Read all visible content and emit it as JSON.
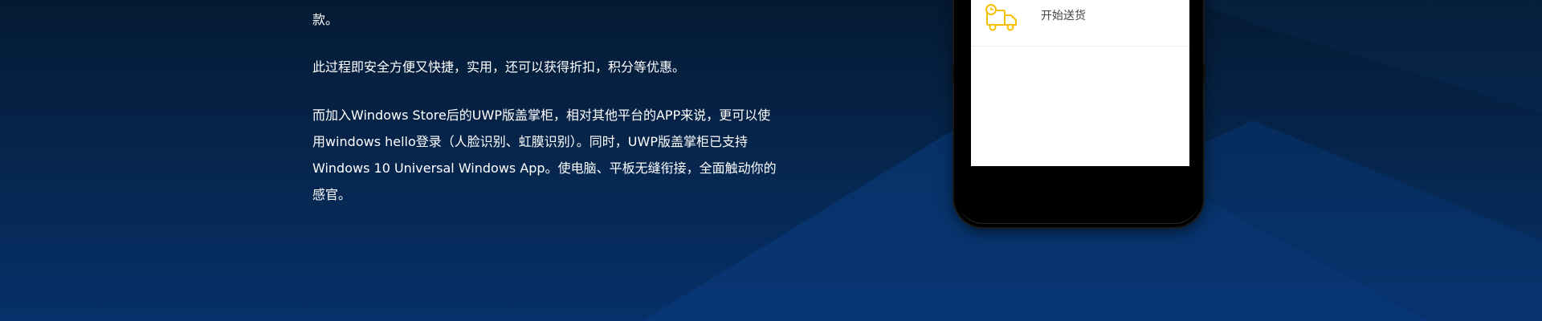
{
  "content": {
    "paragraphs": [
      "款。",
      "此过程即安全方便又快捷，实用，还可以获得折扣，积分等优惠。"
    ],
    "paragraph3_lines": [
      "而加入Windows Store后的UWP版盖掌柜，相对其他平台的APP来说，更可以使",
      "用windows hello登录（人脸识别、虹膜识别）。同时，UWP版盖掌柜已支持",
      "Windows 10 Universal Windows App。使电脑、平板无缝衔接，全面触动你的",
      "感官。"
    ]
  },
  "phone": {
    "list_item": {
      "icon": "delivery-truck-icon",
      "label": "开始送货"
    }
  },
  "colors": {
    "background_top": "#041a33",
    "background_bottom": "#07306a",
    "icon_accent": "#f6c000"
  }
}
